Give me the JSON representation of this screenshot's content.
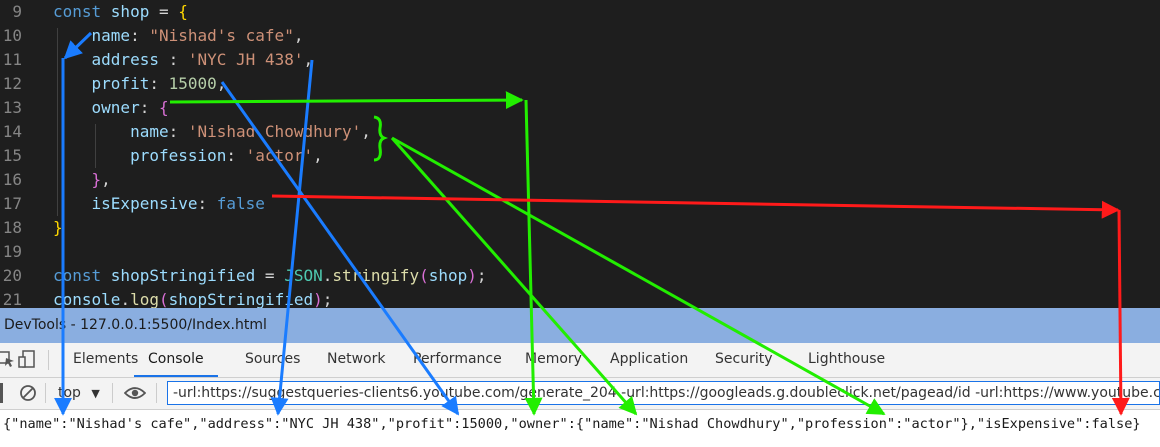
{
  "editor": {
    "lines": [
      {
        "num": "9",
        "tokens": [
          [
            "const ",
            "k-blue"
          ],
          [
            "shop",
            "k-var"
          ],
          [
            " = ",
            ""
          ],
          [
            "{",
            "k-gold"
          ]
        ]
      },
      {
        "num": "10",
        "tokens": [
          [
            "    ",
            ""
          ],
          [
            "name",
            "k-var"
          ],
          [
            ": ",
            ""
          ],
          [
            "\"Nishad's cafe\"",
            "k-str"
          ],
          [
            ",",
            ""
          ]
        ]
      },
      {
        "num": "11",
        "tokens": [
          [
            "    ",
            ""
          ],
          [
            "address",
            "k-var"
          ],
          [
            " : ",
            ""
          ],
          [
            "'NYC JH 438'",
            "k-str"
          ],
          [
            ",",
            ""
          ]
        ]
      },
      {
        "num": "12",
        "tokens": [
          [
            "    ",
            ""
          ],
          [
            "profit",
            "k-var"
          ],
          [
            ": ",
            ""
          ],
          [
            "15000",
            "k-num"
          ],
          [
            ",",
            ""
          ]
        ]
      },
      {
        "num": "13",
        "tokens": [
          [
            "    ",
            ""
          ],
          [
            "owner",
            "k-var"
          ],
          [
            ": ",
            ""
          ],
          [
            "{",
            "k-pink"
          ]
        ]
      },
      {
        "num": "14",
        "tokens": [
          [
            "        ",
            ""
          ],
          [
            "name",
            "k-var"
          ],
          [
            ": ",
            ""
          ],
          [
            "'Nishad Chowdhury'",
            "k-str"
          ],
          [
            ",",
            ""
          ]
        ]
      },
      {
        "num": "15",
        "tokens": [
          [
            "        ",
            ""
          ],
          [
            "profession",
            "k-var"
          ],
          [
            ": ",
            ""
          ],
          [
            "'actor'",
            "k-str"
          ],
          [
            ",",
            ""
          ]
        ]
      },
      {
        "num": "16",
        "tokens": [
          [
            "    ",
            ""
          ],
          [
            "}",
            "k-pink"
          ],
          [
            ",",
            ""
          ]
        ]
      },
      {
        "num": "17",
        "tokens": [
          [
            "    ",
            ""
          ],
          [
            "isExpensive",
            "k-var"
          ],
          [
            ": ",
            ""
          ],
          [
            "false",
            "k-blue"
          ]
        ]
      },
      {
        "num": "18",
        "tokens": [
          [
            "}",
            "k-gold"
          ]
        ]
      },
      {
        "num": "19",
        "tokens": []
      },
      {
        "num": "20",
        "tokens": [
          [
            "const ",
            "k-blue"
          ],
          [
            "shopStringified",
            "k-var"
          ],
          [
            " = ",
            ""
          ],
          [
            "JSON",
            "k-cls"
          ],
          [
            ".",
            ""
          ],
          [
            "stringify",
            "k-fn"
          ],
          [
            "(",
            "k-pink"
          ],
          [
            "shop",
            "k-var"
          ],
          [
            ")",
            "k-pink"
          ],
          [
            ";",
            ""
          ]
        ]
      },
      {
        "num": "21",
        "tokens": [
          [
            "console",
            "k-var"
          ],
          [
            ".",
            ""
          ],
          [
            "log",
            "k-fn"
          ],
          [
            "(",
            "k-pink"
          ],
          [
            "shopStringified",
            "k-var"
          ],
          [
            ")",
            "k-pink"
          ],
          [
            ";",
            ""
          ]
        ]
      }
    ]
  },
  "devtools": {
    "title": "DevTools - 127.0.0.1:5500/Index.html",
    "tabs": [
      "Elements",
      "Console",
      "Sources",
      "Network",
      "Performance",
      "Memory",
      "Application",
      "Security",
      "Lighthouse"
    ],
    "active_tab": "Console",
    "context_label": "top",
    "filter_value": "-url:https://suggestqueries-clients6.youtube.com/generate_204 -url:https://googleads.g.doubleclick.net/pagead/id -url:https://www.youtube.com/youtu",
    "console_output": "{\"name\":\"Nishad's cafe\",\"address\":\"NYC JH 438\",\"profit\":15000,\"owner\":{\"name\":\"Nishad Chowdhury\",\"profession\":\"actor\"},\"isExpensive\":false}"
  },
  "annotation_colors": {
    "blue": "#1a7cff",
    "green": "#22ee00",
    "red": "#ff1a1a"
  }
}
